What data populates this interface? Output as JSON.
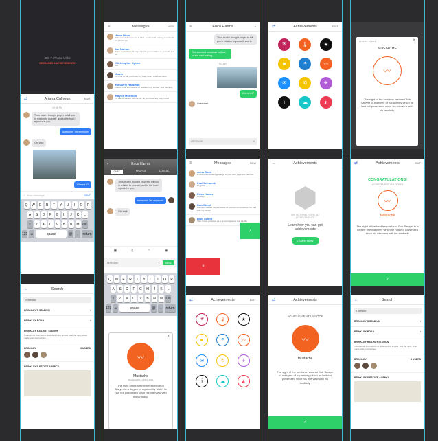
{
  "intro": {
    "title": "iOS 7 iPhone UI kit",
    "subtitle": "MESSAGES & ACHIEVEMENTS"
  },
  "chat1": {
    "title": "Ariana Calhoun",
    "edit": "EDIT",
    "time": "10:58 PM",
    "msg1": "Thus much I thought proper to tell you in relation to yourself, and to the trust I reposed in you.",
    "msg2": "Awesome! Tell me more!",
    "msg3": "Oh! Wait",
    "msg4": "Where's it?",
    "input_placeholder": "Your message",
    "send": "SEND"
  },
  "keyboard": {
    "row1": [
      "Q",
      "W",
      "E",
      "R",
      "T",
      "Y",
      "U",
      "I",
      "O",
      "P"
    ],
    "row2": [
      "A",
      "S",
      "D",
      "F",
      "G",
      "H",
      "J",
      "K",
      "L"
    ],
    "row3": [
      "⇧",
      "Z",
      "X",
      "C",
      "V",
      "B",
      "N",
      "M",
      "⌫"
    ],
    "row4": [
      "123",
      "☺",
      "space",
      "@",
      ".",
      "return"
    ]
  },
  "messages": {
    "title": "Messages",
    "new": "NEW",
    "items": [
      {
        "name": "Anna Blum",
        "text": "This sounded nonsense to Alice, so she said nothing, but set off at a brisk rate"
      },
      {
        "name": "Ina Nathan",
        "text": "Thus much I thought proper to tell you in relation to yourself, and to"
      },
      {
        "name": "Christopher Ogden",
        "text": "Ok"
      },
      {
        "name": "Gavin",
        "text": "Tell me, sir, do you know any body here? And how came"
      },
      {
        "name": "Kimberly Hardman",
        "text": "It was some time before he obtained any answer, and the reply"
      },
      {
        "name": "Kaylee Morrison",
        "text": "To Feliks Nutrient Tell me, sir, do you know any body here?"
      }
    ]
  },
  "chat2": {
    "title": "Erica Harms",
    "msg1": "Thus much I thought proper to tell you in relation to yourself, and to",
    "msg2": "This sounded nonsense to Alice, so she said nothing",
    "today": "TODAY",
    "msg3": "Where's it?",
    "msg4": "Awesome!",
    "input": "MESSAGE"
  },
  "chat3": {
    "name": "Erica Harms",
    "tabs": [
      "CHAT",
      "PROFILE",
      "CONTACT"
    ],
    "msg1": "Thus much I thought proper to tell you in relation to yourself, and to the trust I reposed in you.",
    "msg2": "Awesome! Tell me more!",
    "msg3": "Oh! Wait",
    "input": "Message",
    "send": "SEND"
  },
  "messages2": {
    "title": "Messages",
    "new": "NEW",
    "items": [
      {
        "name": "Anna Blum",
        "text": "A hundred thousand greetings to your dear papa and mamma"
      },
      {
        "name": "Paul Zemanek",
        "text": "Hi, guys!"
      },
      {
        "name": "Erica Harms",
        "text": "No way!"
      },
      {
        "name": "Brin Steed",
        "text": "I've since settled the substance of several conversations I've had with my master"
      },
      {
        "name": "Blair Scmitt",
        "text": "That I have produced as a great eloquence and the firs"
      }
    ]
  },
  "achievements": {
    "title": "Achievements",
    "edit": "EDIT"
  },
  "empty": {
    "title": "Achievements",
    "note": "OH! NOTHING HERE! NO ACHIEVEMENTS",
    "info": "Learn how you can get achievements",
    "cta": "LEARN HOW"
  },
  "modal": {
    "date": "22 APRIL 16 2014",
    "name": "MUSTACHE",
    "body": "The sight of the tumblers restored Bob Sawyer to a degree of equanimity which he had not possessed since his interview with his landlady."
  },
  "congrats": {
    "title": "Achievements",
    "edit": "EDIT",
    "headline": "CONGRATULATIONS!",
    "sub": "ACHIEVEMENT UNLOCKED",
    "name": "Mustache",
    "body": "The sight of the tumblers restored Bob Sawyer to a degree of equanimity which he had not possessed since his interview with his landlady."
  },
  "unlock": {
    "title": "Achievements",
    "headline": "ACHIEVEMENT UNLOCK",
    "name": "Mustache",
    "body": "The sight of the tumblers restored Bob Sawyer to a degree of equanimity which he had not possessed since his interview with his landlady."
  },
  "search": {
    "title": "Search",
    "query": "Brinkle",
    "r1": "BRINKLEY'S STADIUM",
    "r2": "BRINKLEY ROAD",
    "r3": "BRINKLEY RAILWAY STATION",
    "r3text": "It was some time before he obtained any answer, and the reply, when made, was unpropitious.",
    "r4": "BRINKLEY",
    "users": "3 USERS",
    "r5": "BRINKLEY'S ESTATE AGENCY"
  },
  "popup": {
    "name": "Mustache",
    "date": "RECEIVED 16 APRIL 2014",
    "body": "The sight of the tumblers restored Bob Sawyer to a degree of equanimity which he had not possessed since his interview with his landlady."
  }
}
